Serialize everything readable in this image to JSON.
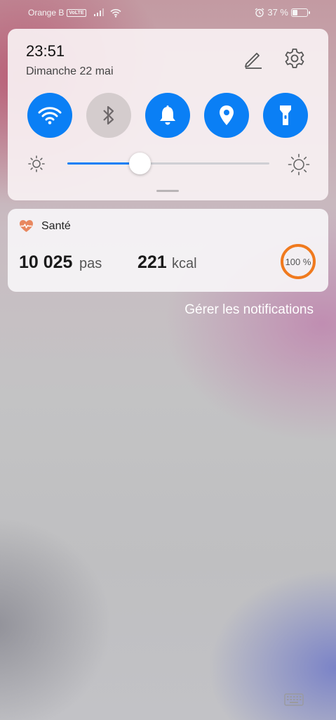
{
  "status_bar": {
    "carrier": "Orange B",
    "volte_badge": "VoLTE",
    "signal_icon": "cell-signal-icon",
    "wifi_icon": "wifi-icon",
    "alarm_icon": "alarm-clock-icon",
    "battery_text": "37 %",
    "battery_level": 0.37
  },
  "quick_panel": {
    "time": "23:51",
    "date": "Dimanche 22 mai",
    "edit_icon": "pencil-icon",
    "settings_icon": "gear-icon",
    "toggles": [
      {
        "name": "wifi",
        "icon": "wifi-icon",
        "state": "on"
      },
      {
        "name": "bluetooth",
        "icon": "bluetooth-icon",
        "state": "off"
      },
      {
        "name": "sound",
        "icon": "bell-icon",
        "state": "on"
      },
      {
        "name": "location",
        "icon": "location-pin-icon",
        "state": "on"
      },
      {
        "name": "flashlight",
        "icon": "flashlight-icon",
        "state": "on"
      }
    ],
    "brightness_level": 0.36,
    "brightness_low_icon": "sun-low-icon",
    "brightness_high_icon": "sun-high-icon"
  },
  "notification": {
    "app_icon": "heart-pulse-icon",
    "app_name": "Santé",
    "steps_value": "10 025",
    "steps_unit": "pas",
    "kcal_value": "221",
    "kcal_unit": "kcal",
    "progress_label": "100 %",
    "progress": 1.0
  },
  "manage_notifications": "Gérer les notifications",
  "nav": {
    "keyboard_icon": "keyboard-icon"
  },
  "colors": {
    "accent": "#0a7ff5",
    "toggle_off": "#d4cccd",
    "ring": "#f07a1e"
  }
}
